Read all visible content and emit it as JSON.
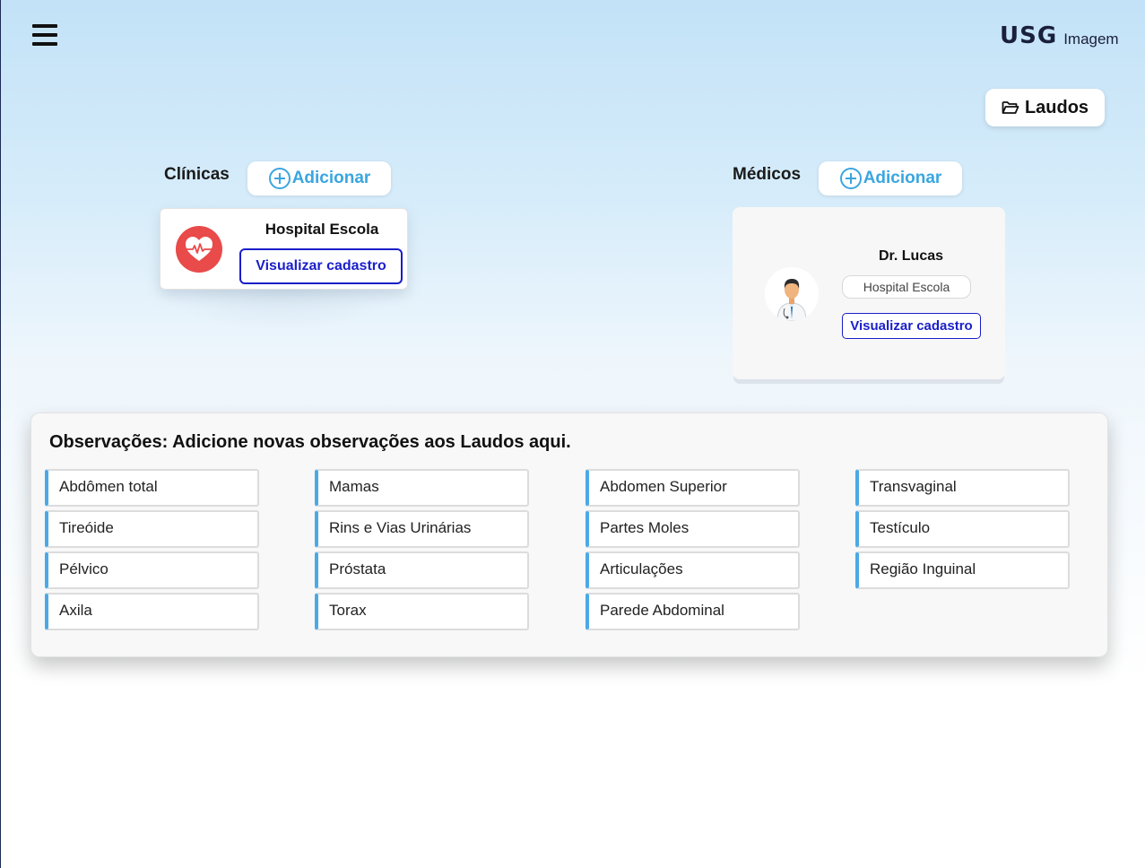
{
  "brand": {
    "name": "USG",
    "suffix": "Imagem"
  },
  "header": {
    "laudos_label": "Laudos"
  },
  "clinics": {
    "title": "Clínicas",
    "add_label": "Adicionar",
    "items": [
      {
        "name": "Hospital Escola",
        "view_label": "Visualizar cadastro"
      }
    ]
  },
  "doctors": {
    "title": "Médicos",
    "add_label": "Adicionar",
    "items": [
      {
        "name": "Dr. Lucas",
        "hospital": "Hospital Escola",
        "view_label": "Visualizar cadastro"
      }
    ]
  },
  "observations": {
    "title": "Observações: Adicione novas observações aos Laudos aqui.",
    "columns": [
      [
        "Abdômen total",
        "Tireóide",
        "Pélvico",
        "Axila"
      ],
      [
        "Mamas",
        "Rins e Vias Urinárias",
        "Próstata",
        "Torax"
      ],
      [
        "Abdomen Superior",
        "Partes Moles",
        "Articulações",
        "Parede Abdominal"
      ],
      [
        "Transvaginal",
        "Testículo",
        "Região Inguinal"
      ]
    ]
  },
  "colors": {
    "accent": "#4ca9e6",
    "link": "#1a1ec9",
    "clinic_icon": "#e94a4a"
  },
  "icons": [
    "menu-icon",
    "folder-open-icon",
    "plus-circle-icon",
    "heart-pulse-icon",
    "doctor-avatar-icon"
  ]
}
